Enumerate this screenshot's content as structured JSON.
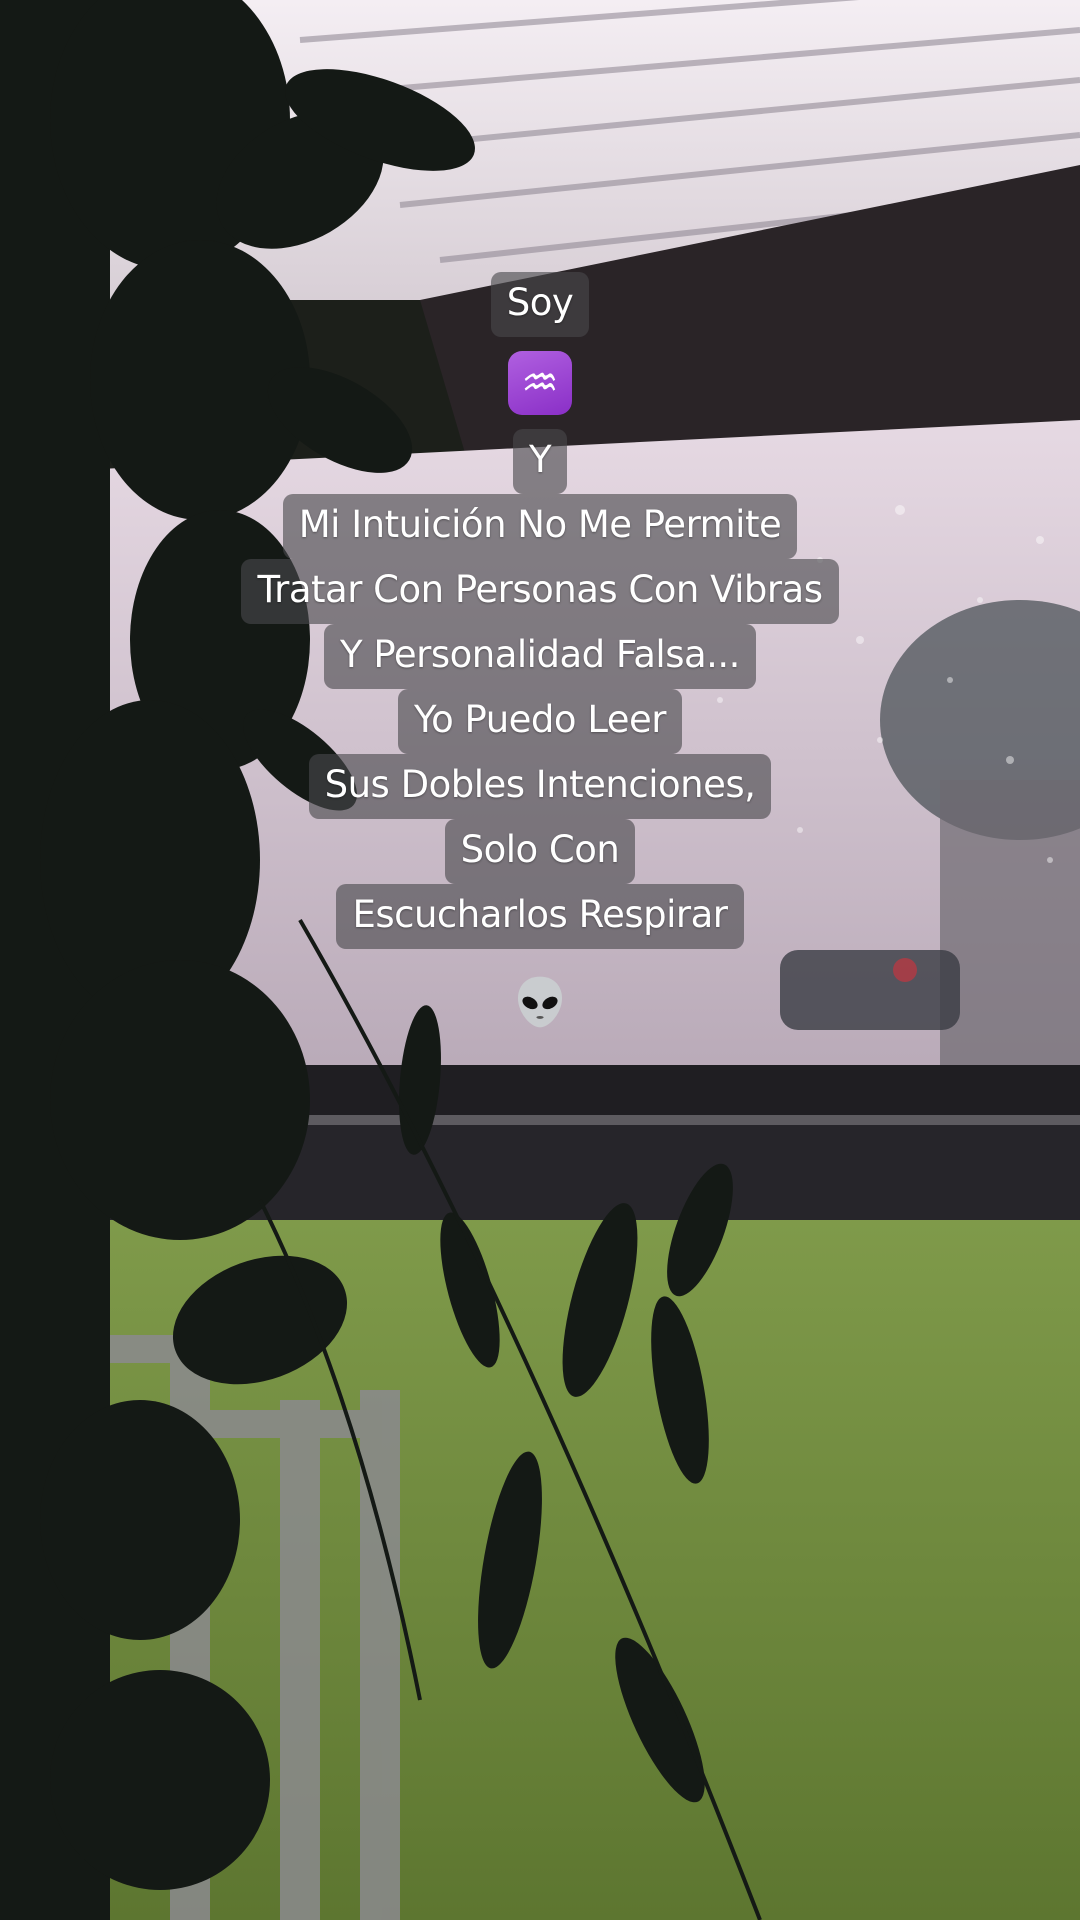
{
  "story": {
    "lines_top": [
      "Soy"
    ],
    "zodiac_icon": "aquarius-icon",
    "zodiac_glyph": "♒",
    "lines_main": [
      "Y",
      "Mi Intuición No Me Permite",
      "Tratar Con Personas Con Vibras",
      "Y Personalidad Falsa...",
      "Yo Puedo Leer",
      "Sus Dobles Intenciones,",
      "Solo Con",
      "Escucharlos Respirar"
    ],
    "closing_icon": "alien-icon"
  },
  "colors": {
    "caption_bg": "#48484c",
    "caption_text": "#ffffff",
    "zodiac_badge": "#9b44d4",
    "sky": "#d9c9d6",
    "grass": "#6f8a3a"
  }
}
